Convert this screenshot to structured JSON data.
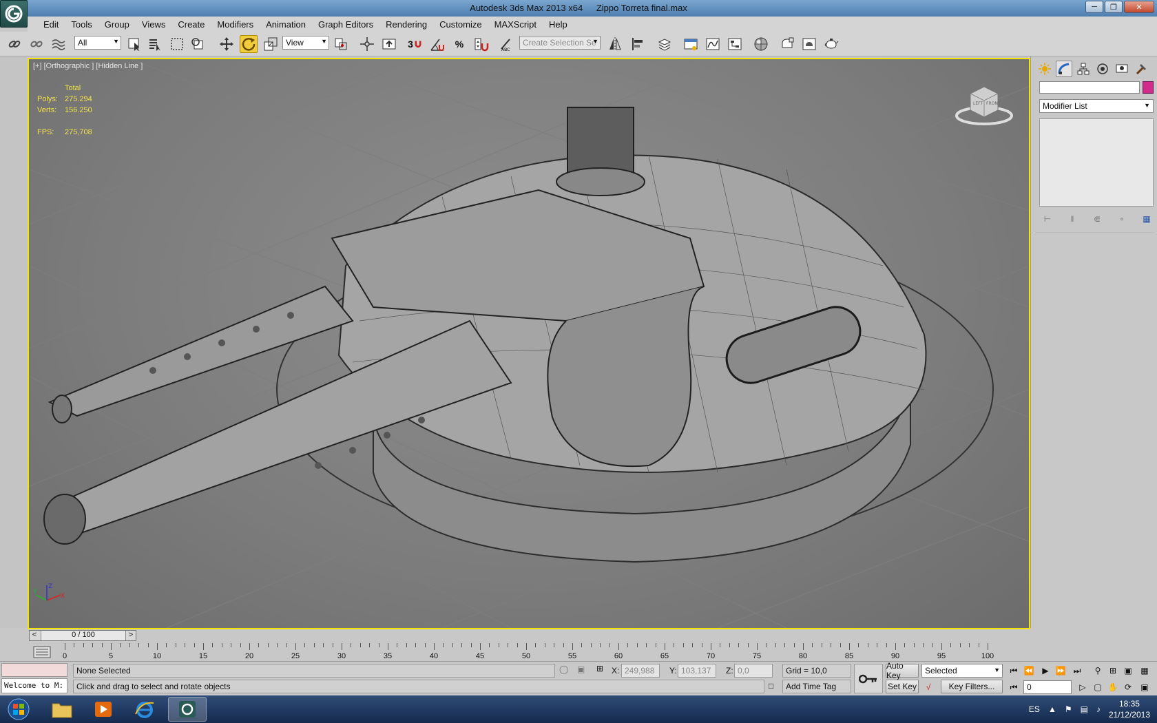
{
  "window": {
    "app_title": "Autodesk 3ds Max  2013 x64",
    "file_title": "Zippo Torreta final.max"
  },
  "menu": [
    "Edit",
    "Tools",
    "Group",
    "Views",
    "Create",
    "Modifiers",
    "Animation",
    "Graph Editors",
    "Rendering",
    "Customize",
    "MAXScript",
    "Help"
  ],
  "toolbar": {
    "selection_filter": "All",
    "ref_coord_system": "View",
    "snap_label": "3",
    "named_selection_placeholder": "Create Selection Se"
  },
  "viewport": {
    "label": "[+] [Orthographic ] [Hidden Line ]",
    "stats": {
      "header": "Total",
      "polys_label": "Polys:",
      "polys_value": "275.294",
      "verts_label": "Verts:",
      "verts_value": "156.250",
      "fps_label": "FPS:",
      "fps_value": "275,708"
    },
    "viewcube": {
      "left": "LEFT",
      "front": "FRONT"
    },
    "axis": {
      "x": "X",
      "y": "Y",
      "z": "Z"
    }
  },
  "command_panel": {
    "modifier_list": "Modifier List",
    "object_color": "#d12c8c"
  },
  "time_slider": {
    "prev": "<",
    "value": "0 / 100",
    "next": ">"
  },
  "track_bar": {
    "labels": [
      "0",
      "5",
      "10",
      "15",
      "20",
      "25",
      "30",
      "35",
      "40",
      "45",
      "50",
      "55",
      "60",
      "65",
      "70",
      "75",
      "80",
      "85",
      "90",
      "95",
      "100"
    ]
  },
  "status": {
    "maxscript_listener": "Welcome to M:",
    "selection": "None Selected",
    "prompt": "Click and drag to select and rotate objects",
    "x_label": "X:",
    "x_value": "249,988",
    "y_label": "Y:",
    "y_value": "103,137",
    "z_label": "Z:",
    "z_value": "0,0",
    "grid": "Grid = 10,0",
    "add_time_tag": "Add Time Tag",
    "auto_key": "Auto Key",
    "set_key": "Set Key",
    "key_mode": "Selected",
    "key_filters": "Key Filters...",
    "current_frame": "0"
  },
  "taskbar": {
    "language": "ES",
    "time": "18:35",
    "date": "21/12/2013"
  }
}
